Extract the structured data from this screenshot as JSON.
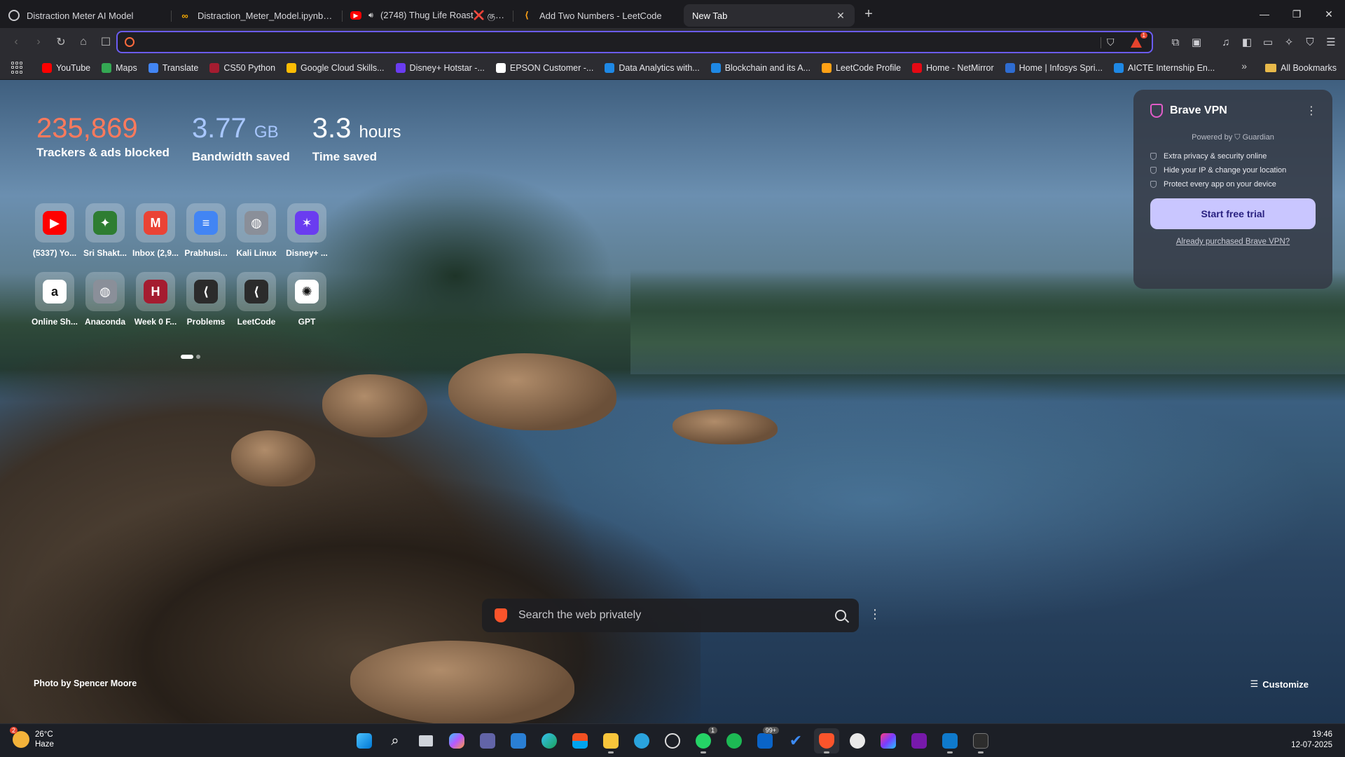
{
  "tabs": [
    {
      "title": "Distraction Meter AI Model",
      "icon": "globe-icon",
      "color": "#9aa0a6"
    },
    {
      "title": "Distraction_Meter_Model.ipynb - Col",
      "icon": "colab-icon",
      "color": "#f9ab00"
    },
    {
      "title": "(2748) Thug Life Roast❌ குடும",
      "icon": "youtube-icon",
      "color": "#ff0000"
    },
    {
      "title": "Add Two Numbers - LeetCode",
      "icon": "leetcode-icon",
      "color": "#ffa116"
    },
    {
      "title": "New Tab",
      "icon": "",
      "color": ""
    }
  ],
  "rewards_badge": "1",
  "bookmarks": [
    {
      "label": "YouTube",
      "color": "#ff0000"
    },
    {
      "label": "Maps",
      "color": "#34a853"
    },
    {
      "label": "Translate",
      "color": "#4285f4"
    },
    {
      "label": "CS50 Python",
      "color": "#a51c30"
    },
    {
      "label": "Google Cloud Skills...",
      "color": "#fbbc04"
    },
    {
      "label": "Disney+ Hotstar -...",
      "color": "#6a3cf0"
    },
    {
      "label": "EPSON Customer -...",
      "color": "#ffffff"
    },
    {
      "label": "Data Analytics with...",
      "color": "#1e88e5"
    },
    {
      "label": "Blockchain and its A...",
      "color": "#1e88e5"
    },
    {
      "label": "LeetCode Profile",
      "color": "#ffa116"
    },
    {
      "label": "Home - NetMirror",
      "color": "#e50914"
    },
    {
      "label": "Home | Infosys Spri...",
      "color": "#2e6cd1"
    },
    {
      "label": "AICTE Internship En...",
      "color": "#1e88e5"
    }
  ],
  "all_bookmarks_label": "All Bookmarks",
  "stats": {
    "trackers": {
      "value": "235,869",
      "label": "Trackers & ads blocked"
    },
    "bandwidth": {
      "value": "3.77",
      "unit": "GB",
      "label": "Bandwidth saved"
    },
    "time": {
      "value": "3.3",
      "unit": "hours",
      "label": "Time saved"
    }
  },
  "top_sites": [
    {
      "name": "(5337) Yo...",
      "icon": "youtube-icon",
      "bg": "#ff0000",
      "glyph": "▶"
    },
    {
      "name": "Sri Shakt...",
      "icon": "college-crest-icon",
      "bg": "#2e7d32",
      "glyph": "✦"
    },
    {
      "name": "Inbox (2,9...",
      "icon": "gmail-icon",
      "bg": "#ea4335",
      "glyph": "M"
    },
    {
      "name": "Prabhusi...",
      "icon": "docs-icon",
      "bg": "#4285f4",
      "glyph": "≡"
    },
    {
      "name": "Kali Linux",
      "icon": "globe-icon",
      "bg": "#8a8f99",
      "glyph": "◍"
    },
    {
      "name": "Disney+ ...",
      "icon": "disney-icon",
      "bg": "#6a3cf0",
      "glyph": "✶"
    },
    {
      "name": "Online Sh...",
      "icon": "amazon-icon",
      "bg": "#ffffff",
      "glyph": "a"
    },
    {
      "name": "Anaconda",
      "icon": "globe-icon",
      "bg": "#8a8f99",
      "glyph": "◍"
    },
    {
      "name": "Week 0 F...",
      "icon": "harvard-icon",
      "bg": "#a51c30",
      "glyph": "H"
    },
    {
      "name": "Problems",
      "icon": "leetcode-icon",
      "bg": "#2b2b2b",
      "glyph": "⟨"
    },
    {
      "name": "LeetCode",
      "icon": "leetcode-icon",
      "bg": "#2b2b2b",
      "glyph": "⟨"
    },
    {
      "name": "GPT",
      "icon": "chatgpt-icon",
      "bg": "#ffffff",
      "glyph": "✺"
    }
  ],
  "vpn": {
    "title": "Brave VPN",
    "powered_by": "Powered by ⛉ Guardian",
    "features": [
      "Extra privacy & security online",
      "Hide your IP & change your location",
      "Protect every app on your device"
    ],
    "cta": "Start free trial",
    "link": "Already purchased Brave VPN?"
  },
  "search": {
    "placeholder": "Search the web privately"
  },
  "photo_credit": "Photo by Spencer Moore",
  "customize_label": "Customize",
  "taskbar": {
    "weather_temp": "26°C",
    "weather_desc": "Haze",
    "weather_badge": "2",
    "time": "19:46",
    "date": "12-07-2025",
    "whatsapp_badge": "1",
    "outlook_badge": "99+"
  }
}
